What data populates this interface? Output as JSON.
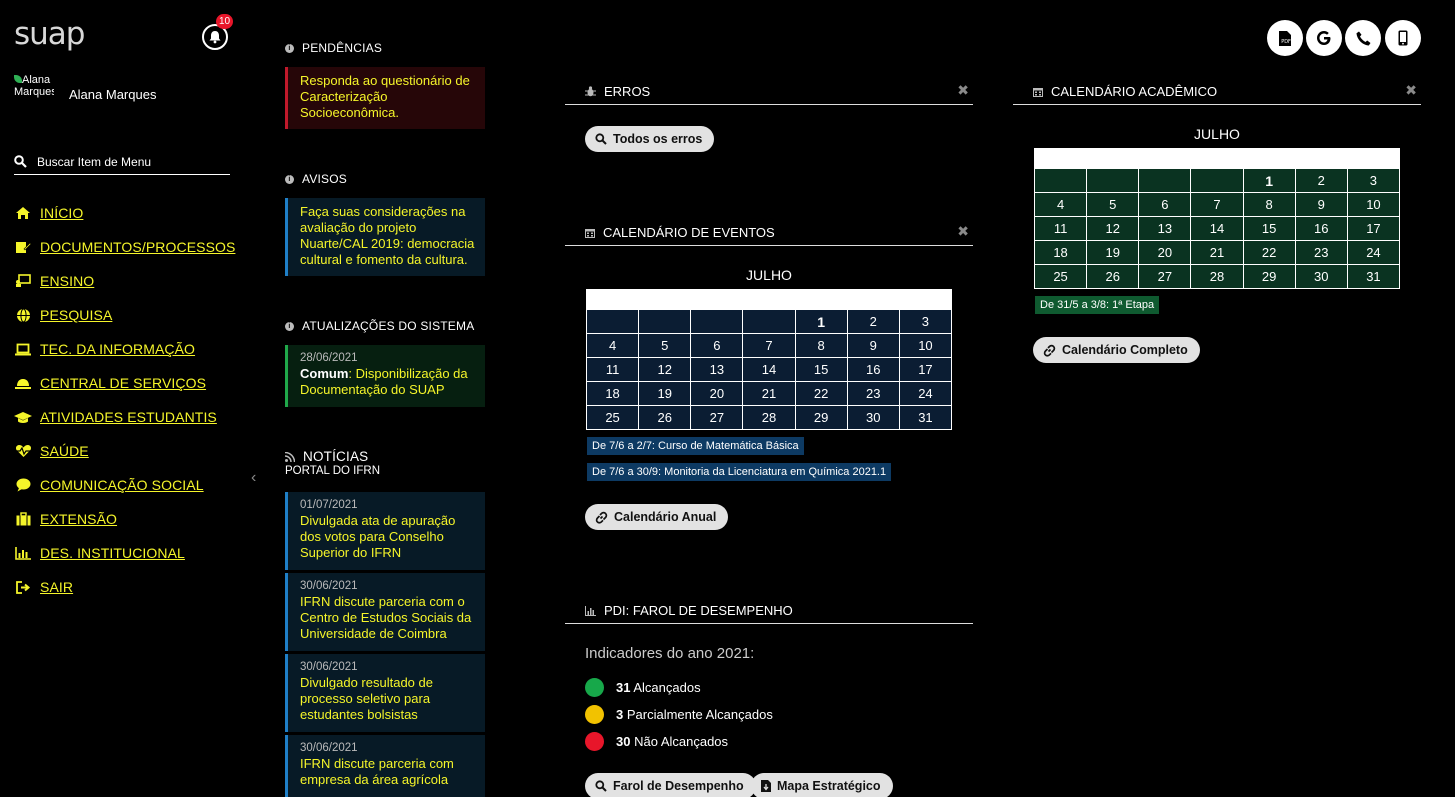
{
  "app": {
    "logo": "suap",
    "notifications_count": "10"
  },
  "user": {
    "name": "Alana Marques",
    "avatar_alt": "Alana Marques"
  },
  "search": {
    "placeholder": "Buscar Item de Menu"
  },
  "menu": [
    {
      "label": "INÍCIO",
      "icon": "home-icon"
    },
    {
      "label": "DOCUMENTOS/PROCESSOS",
      "icon": "documents-icon"
    },
    {
      "label": "ENSINO",
      "icon": "teaching-icon"
    },
    {
      "label": "PESQUISA",
      "icon": "globe-icon"
    },
    {
      "label": "TEC. DA INFORMAÇÃO",
      "icon": "laptop-icon"
    },
    {
      "label": "CENTRAL DE SERVIÇOS",
      "icon": "service-bell-icon"
    },
    {
      "label": "ATIVIDADES ESTUDANTIS",
      "icon": "graduation-cap-icon"
    },
    {
      "label": "SAÚDE",
      "icon": "heartbeat-icon"
    },
    {
      "label": "COMUNICAÇÃO SOCIAL",
      "icon": "chat-bubble-icon"
    },
    {
      "label": "EXTENSÃO",
      "icon": "briefcase-icon"
    },
    {
      "label": "DES. INSTITUCIONAL",
      "icon": "bar-chart-icon"
    },
    {
      "label": "SAIR",
      "icon": "sign-out-icon"
    }
  ],
  "pendencias": {
    "title": "PENDÊNCIAS",
    "items": [
      "Responda ao questionário de Caracterização Socioeconômica."
    ]
  },
  "avisos": {
    "title": "AVISOS",
    "items": [
      "Faça suas considerações na avaliação do projeto Nuarte/CAL 2019: democracia cultural e fomento da cultura."
    ]
  },
  "atualizacoes": {
    "title": "ATUALIZAÇÕES DO SISTEMA",
    "date": "28/06/2021",
    "module": "Comum",
    "text": ": Disponibilização da Documentação do SUAP"
  },
  "noticias": {
    "title": "NOTÍCIAS",
    "subtitle": "PORTAL DO IFRN",
    "items": [
      {
        "date": "01/07/2021",
        "text": "Divulgada ata de apuração dos votos para Conselho Superior do IFRN"
      },
      {
        "date": "30/06/2021",
        "text": "IFRN discute parceria com o Centro de Estudos Sociais da Universidade de Coimbra"
      },
      {
        "date": "30/06/2021",
        "text": "Divulgado resultado de processo seletivo para estudantes bolsistas"
      },
      {
        "date": "30/06/2021",
        "text": "IFRN discute parceria com empresa da área agrícola"
      }
    ]
  },
  "erros": {
    "title": "ERROS",
    "button": "Todos os erros",
    "close": "✖"
  },
  "calendario_eventos": {
    "title": "CALENDÁRIO DE EVENTOS",
    "month": "JULHO",
    "weeks": [
      [
        "",
        "",
        "",
        "",
        "1",
        "2",
        "3"
      ],
      [
        "4",
        "5",
        "6",
        "7",
        "8",
        "9",
        "10"
      ],
      [
        "11",
        "12",
        "13",
        "14",
        "15",
        "16",
        "17"
      ],
      [
        "18",
        "19",
        "20",
        "21",
        "22",
        "23",
        "24"
      ],
      [
        "25",
        "26",
        "27",
        "28",
        "29",
        "30",
        "31"
      ]
    ],
    "today": "1",
    "events": [
      "De 7/6 a 2/7: Curso de Matemática Básica",
      "De 7/6 a 30/9: Monitoria da Licenciatura em Química 2021.1"
    ],
    "button": "Calendário Anual",
    "close": "✖"
  },
  "calendario_academico": {
    "title": "CALENDÁRIO ACADÊMICO",
    "month": "JULHO",
    "weeks": [
      [
        "",
        "",
        "",
        "",
        "1",
        "2",
        "3"
      ],
      [
        "4",
        "5",
        "6",
        "7",
        "8",
        "9",
        "10"
      ],
      [
        "11",
        "12",
        "13",
        "14",
        "15",
        "16",
        "17"
      ],
      [
        "18",
        "19",
        "20",
        "21",
        "22",
        "23",
        "24"
      ],
      [
        "25",
        "26",
        "27",
        "28",
        "29",
        "30",
        "31"
      ]
    ],
    "today": "1",
    "events": [
      "De 31/5 a 3/8: 1ª Etapa"
    ],
    "button": "Calendário Completo",
    "close": "✖"
  },
  "pdi": {
    "title": "PDI: FAROL DE DESEMPENHO",
    "subtitle": "Indicadores do ano 2021:",
    "items": [
      {
        "count": "31",
        "label": " Alcançados",
        "color": "#17a84a"
      },
      {
        "count": "3",
        "label": " Parcialmente Alcançados",
        "color": "#f2c200"
      },
      {
        "count": "30",
        "label": " Não Alcançados",
        "color": "#e8162a"
      }
    ],
    "buttons": [
      "Farol de Desempenho",
      "Mapa Estratégico"
    ]
  },
  "top_buttons": [
    "pdf-icon",
    "google-icon",
    "phone-icon",
    "mobile-icon"
  ],
  "colors": {
    "menu_link": "#f5f52a",
    "calendar_events": "#0b1d33",
    "calendar_academic": "#0a3321"
  }
}
